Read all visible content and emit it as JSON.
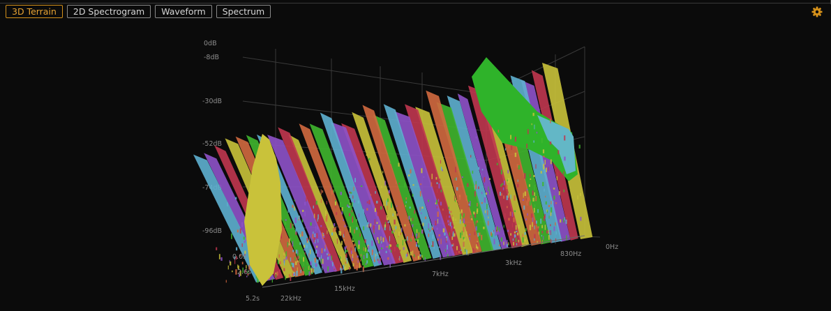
{
  "toolbar": {
    "tabs": [
      {
        "label": "3D Terrain",
        "active": true
      },
      {
        "label": "2D Spectrogram",
        "active": false
      },
      {
        "label": "Waveform",
        "active": false
      },
      {
        "label": "Spectrum",
        "active": false
      }
    ],
    "settings_icon": "gear-icon"
  },
  "colors": {
    "background": "#0b0b0b",
    "accent": "#d4901a",
    "tab_border": "#8a8a8a"
  },
  "chart_data": {
    "type": "terrain",
    "ylabel_ticks": [
      "0dB",
      "-8dB",
      "-30dB",
      "-52dB",
      "-74dB",
      "-96dB"
    ],
    "frequency_ticks": [
      "22kHz",
      "15kHz",
      "7kHz",
      "3kHz",
      "830Hz",
      "0Hz"
    ],
    "time_ticks": [
      "0.0s",
      "2.6s",
      "5.2s"
    ],
    "series_palette": [
      "#c9c23a",
      "#c0364f",
      "#8e52c9",
      "#5eb0d0",
      "#3fb62e",
      "#d2693f"
    ]
  }
}
